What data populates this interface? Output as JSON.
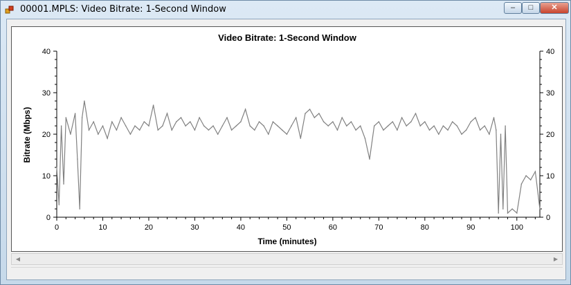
{
  "window": {
    "title": "00001.MPLS: Video Bitrate: 1-Second Window",
    "controls": {
      "minimize": "–",
      "maximize": "□",
      "close": "✕"
    }
  },
  "colors": {
    "series": "#808080",
    "axis": "#000000"
  },
  "scrollbar": {
    "left_arrow": "◀",
    "right_arrow": "▶"
  },
  "chart_data": {
    "type": "line",
    "title": "Video Bitrate: 1-Second Window",
    "xlabel": "Time (minutes)",
    "ylabel": "Bitrate (Mbps)",
    "xlim": [
      0,
      105
    ],
    "ylim": [
      0,
      40
    ],
    "xticks": [
      0,
      10,
      20,
      30,
      40,
      50,
      60,
      70,
      80,
      90,
      100
    ],
    "yticks": [
      0,
      10,
      20,
      30,
      40
    ],
    "grid": false,
    "series": [
      {
        "values": [
          [
            0,
            12
          ],
          [
            0.5,
            3
          ],
          [
            1,
            22
          ],
          [
            1.5,
            8
          ],
          [
            2,
            24
          ],
          [
            3,
            20
          ],
          [
            4,
            25
          ],
          [
            4.5,
            14
          ],
          [
            5,
            2
          ],
          [
            5.5,
            24
          ],
          [
            6,
            28
          ],
          [
            7,
            21
          ],
          [
            8,
            23
          ],
          [
            9,
            20
          ],
          [
            10,
            22
          ],
          [
            11,
            19
          ],
          [
            12,
            23
          ],
          [
            13,
            21
          ],
          [
            14,
            24
          ],
          [
            15,
            22
          ],
          [
            16,
            20
          ],
          [
            17,
            22
          ],
          [
            18,
            21
          ],
          [
            19,
            23
          ],
          [
            20,
            22
          ],
          [
            21,
            27
          ],
          [
            22,
            21
          ],
          [
            23,
            22
          ],
          [
            24,
            25
          ],
          [
            25,
            21
          ],
          [
            26,
            23
          ],
          [
            27,
            24
          ],
          [
            28,
            22
          ],
          [
            29,
            23
          ],
          [
            30,
            21
          ],
          [
            31,
            24
          ],
          [
            32,
            22
          ],
          [
            33,
            21
          ],
          [
            34,
            22
          ],
          [
            35,
            20
          ],
          [
            36,
            22
          ],
          [
            37,
            24
          ],
          [
            38,
            21
          ],
          [
            39,
            22
          ],
          [
            40,
            23
          ],
          [
            41,
            26
          ],
          [
            42,
            22
          ],
          [
            43,
            21
          ],
          [
            44,
            23
          ],
          [
            45,
            22
          ],
          [
            46,
            20
          ],
          [
            47,
            23
          ],
          [
            48,
            22
          ],
          [
            49,
            21
          ],
          [
            50,
            20
          ],
          [
            51,
            22
          ],
          [
            52,
            24
          ],
          [
            53,
            19
          ],
          [
            54,
            25
          ],
          [
            55,
            26
          ],
          [
            56,
            24
          ],
          [
            57,
            25
          ],
          [
            58,
            23
          ],
          [
            59,
            22
          ],
          [
            60,
            23
          ],
          [
            61,
            21
          ],
          [
            62,
            24
          ],
          [
            63,
            22
          ],
          [
            64,
            23
          ],
          [
            65,
            21
          ],
          [
            66,
            22
          ],
          [
            67,
            19
          ],
          [
            68,
            14
          ],
          [
            69,
            22
          ],
          [
            70,
            23
          ],
          [
            71,
            21
          ],
          [
            72,
            22
          ],
          [
            73,
            23
          ],
          [
            74,
            21
          ],
          [
            75,
            24
          ],
          [
            76,
            22
          ],
          [
            77,
            23
          ],
          [
            78,
            25
          ],
          [
            79,
            22
          ],
          [
            80,
            23
          ],
          [
            81,
            21
          ],
          [
            82,
            22
          ],
          [
            83,
            20
          ],
          [
            84,
            22
          ],
          [
            85,
            21
          ],
          [
            86,
            23
          ],
          [
            87,
            22
          ],
          [
            88,
            20
          ],
          [
            89,
            21
          ],
          [
            90,
            23
          ],
          [
            91,
            24
          ],
          [
            92,
            21
          ],
          [
            93,
            22
          ],
          [
            94,
            20
          ],
          [
            95,
            24
          ],
          [
            95.5,
            21
          ],
          [
            96,
            1
          ],
          [
            96.5,
            20
          ],
          [
            97,
            2
          ],
          [
            97.5,
            22
          ],
          [
            98,
            1
          ],
          [
            99,
            2
          ],
          [
            100,
            1
          ],
          [
            101,
            8
          ],
          [
            102,
            10
          ],
          [
            103,
            9
          ],
          [
            104,
            11
          ],
          [
            105,
            2
          ]
        ]
      }
    ]
  }
}
